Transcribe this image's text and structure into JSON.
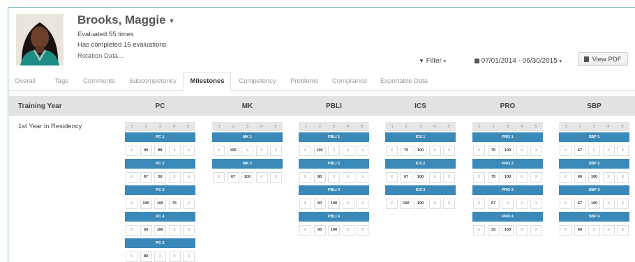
{
  "profile": {
    "name": "Brooks, Maggie",
    "evaluated": "Evaluated 55 times",
    "completed": "Has completed 15 evaluations",
    "rotation": "Rotation Data..."
  },
  "toolbar": {
    "filter_label": "Filter",
    "date_range": "07/01/2014 - 06/30/2015",
    "pdf_label": "View PDF"
  },
  "tabs": [
    {
      "label": "Overall"
    },
    {
      "label": "Tags"
    },
    {
      "label": "Comments"
    },
    {
      "label": "Subcompetency"
    },
    {
      "label": "Milestones",
      "active": true
    },
    {
      "label": "Competency"
    },
    {
      "label": "Problems"
    },
    {
      "label": "Compliance"
    },
    {
      "label": "Exportable Data"
    }
  ],
  "table": {
    "first_header": "Training Year",
    "competencies": [
      "PC",
      "MK",
      "PBLI",
      "ICS",
      "PRO",
      "SBP"
    ],
    "row_label": "1st Year in Residency",
    "scale": [
      "1",
      "2",
      "3",
      "4",
      "5"
    ]
  },
  "milestones": [
    [
      {
        "label": "PC 1",
        "values": [
          "X",
          "90",
          "88",
          "X",
          "X"
        ]
      },
      {
        "label": "PC 2",
        "values": [
          "X",
          "67",
          "50",
          "X",
          "X"
        ]
      },
      {
        "label": "PC 3",
        "values": [
          "X",
          "100",
          "100",
          "75",
          "X"
        ]
      },
      {
        "label": "PC 4",
        "values": [
          "X",
          "50",
          "100",
          "X",
          "X"
        ]
      },
      {
        "label": "PC 5",
        "values": [
          "X",
          "80",
          "X",
          "X",
          "X"
        ]
      }
    ],
    [
      {
        "label": "MK 1",
        "values": [
          "X",
          "100",
          "X",
          "X",
          "X"
        ]
      },
      {
        "label": "MK 2",
        "values": [
          "X",
          "67",
          "100",
          "X",
          "X"
        ]
      }
    ],
    [
      {
        "label": "PBLI 1",
        "values": [
          "X",
          "100",
          "X",
          "X",
          "X"
        ]
      },
      {
        "label": "PBLI 2",
        "values": [
          "X",
          "80",
          "X",
          "X",
          "X"
        ]
      },
      {
        "label": "PBLI 3",
        "values": [
          "X",
          "60",
          "100",
          "X",
          "X"
        ]
      },
      {
        "label": "PBLI 4",
        "values": [
          "X",
          "50",
          "100",
          "X",
          "X"
        ]
      }
    ],
    [
      {
        "label": "ICS 1",
        "values": [
          "X",
          "75",
          "100",
          "X",
          "X"
        ]
      },
      {
        "label": "ICS 2",
        "values": [
          "X",
          "67",
          "100",
          "X",
          "X"
        ]
      },
      {
        "label": "ICS 3",
        "values": [
          "X",
          "100",
          "100",
          "X",
          "X"
        ]
      }
    ],
    [
      {
        "label": "PRO 1",
        "values": [
          "X",
          "75",
          "100",
          "X",
          "X"
        ]
      },
      {
        "label": "PRO 2",
        "values": [
          "X",
          "75",
          "100",
          "X",
          "X"
        ]
      },
      {
        "label": "PRO 3",
        "values": [
          "X",
          "67",
          "X",
          "X",
          "X"
        ]
      },
      {
        "label": "PRO 4",
        "values": [
          "X",
          "33",
          "100",
          "X",
          "X"
        ]
      }
    ],
    [
      {
        "label": "SBP 1",
        "values": [
          "X",
          "67",
          "X",
          "X",
          "X"
        ]
      },
      {
        "label": "SBP 2",
        "values": [
          "X",
          "60",
          "100",
          "X",
          "X"
        ]
      },
      {
        "label": "SBP 3",
        "values": [
          "X",
          "67",
          "100",
          "X",
          "X"
        ]
      },
      {
        "label": "SBP 4",
        "values": [
          "X",
          "60",
          "X",
          "X",
          "X"
        ]
      }
    ]
  ],
  "colors": {
    "milestone_bar": "#3a89b8",
    "header_bg": "#e2e2e2",
    "frame_border": "#7fb8cc"
  },
  "icons": [
    "profile-photo",
    "caret-down-icon",
    "filter-icon",
    "calendar-icon",
    "document-icon"
  ]
}
